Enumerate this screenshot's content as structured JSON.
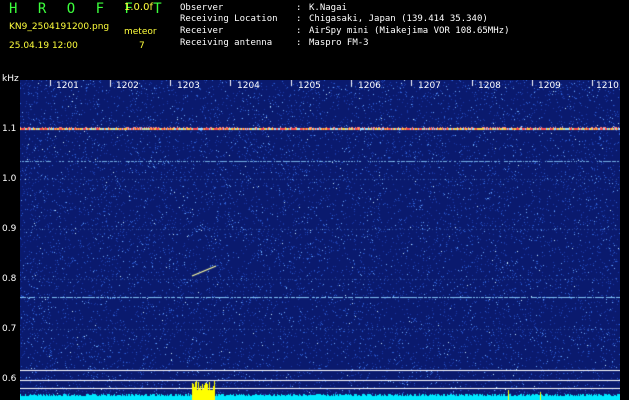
{
  "header": {
    "title": "H R O F F T",
    "version": "1.0.0f",
    "filename": "KN9_2504191200.png",
    "datetime": "25.04.19 12:00",
    "meteor_label": "meteor",
    "meteor_count": "7"
  },
  "info": {
    "observer_label": "Observer",
    "observer_value": "K.Nagai",
    "location_label": "Receiving Location",
    "location_value": "Chigasaki, Japan (139.414 35.340)",
    "receiver_label": "Receiver",
    "receiver_value": "AirSpy mini (Miakejima VOR 108.65MHz)",
    "antenna_label": "Receiving antenna",
    "antenna_value": "Maspro FM-3",
    "separator": ":"
  },
  "axis": {
    "y_unit": "kHz",
    "y_ticks": [
      "1.1",
      "1.0",
      "0.9",
      "0.8",
      "0.7",
      "0.6"
    ],
    "x_ticks": [
      "1201",
      "1202",
      "1203",
      "1204",
      "1205",
      "1206",
      "1207",
      "1208",
      "1209",
      "1210"
    ]
  },
  "colors": {
    "background": "#0a1a6e",
    "noise_bright": "#4a8cff",
    "carrier": "#ff5050",
    "meteor": "#ffffa0",
    "level_bar": "#00e8ff",
    "burst": "#ffff00"
  }
}
